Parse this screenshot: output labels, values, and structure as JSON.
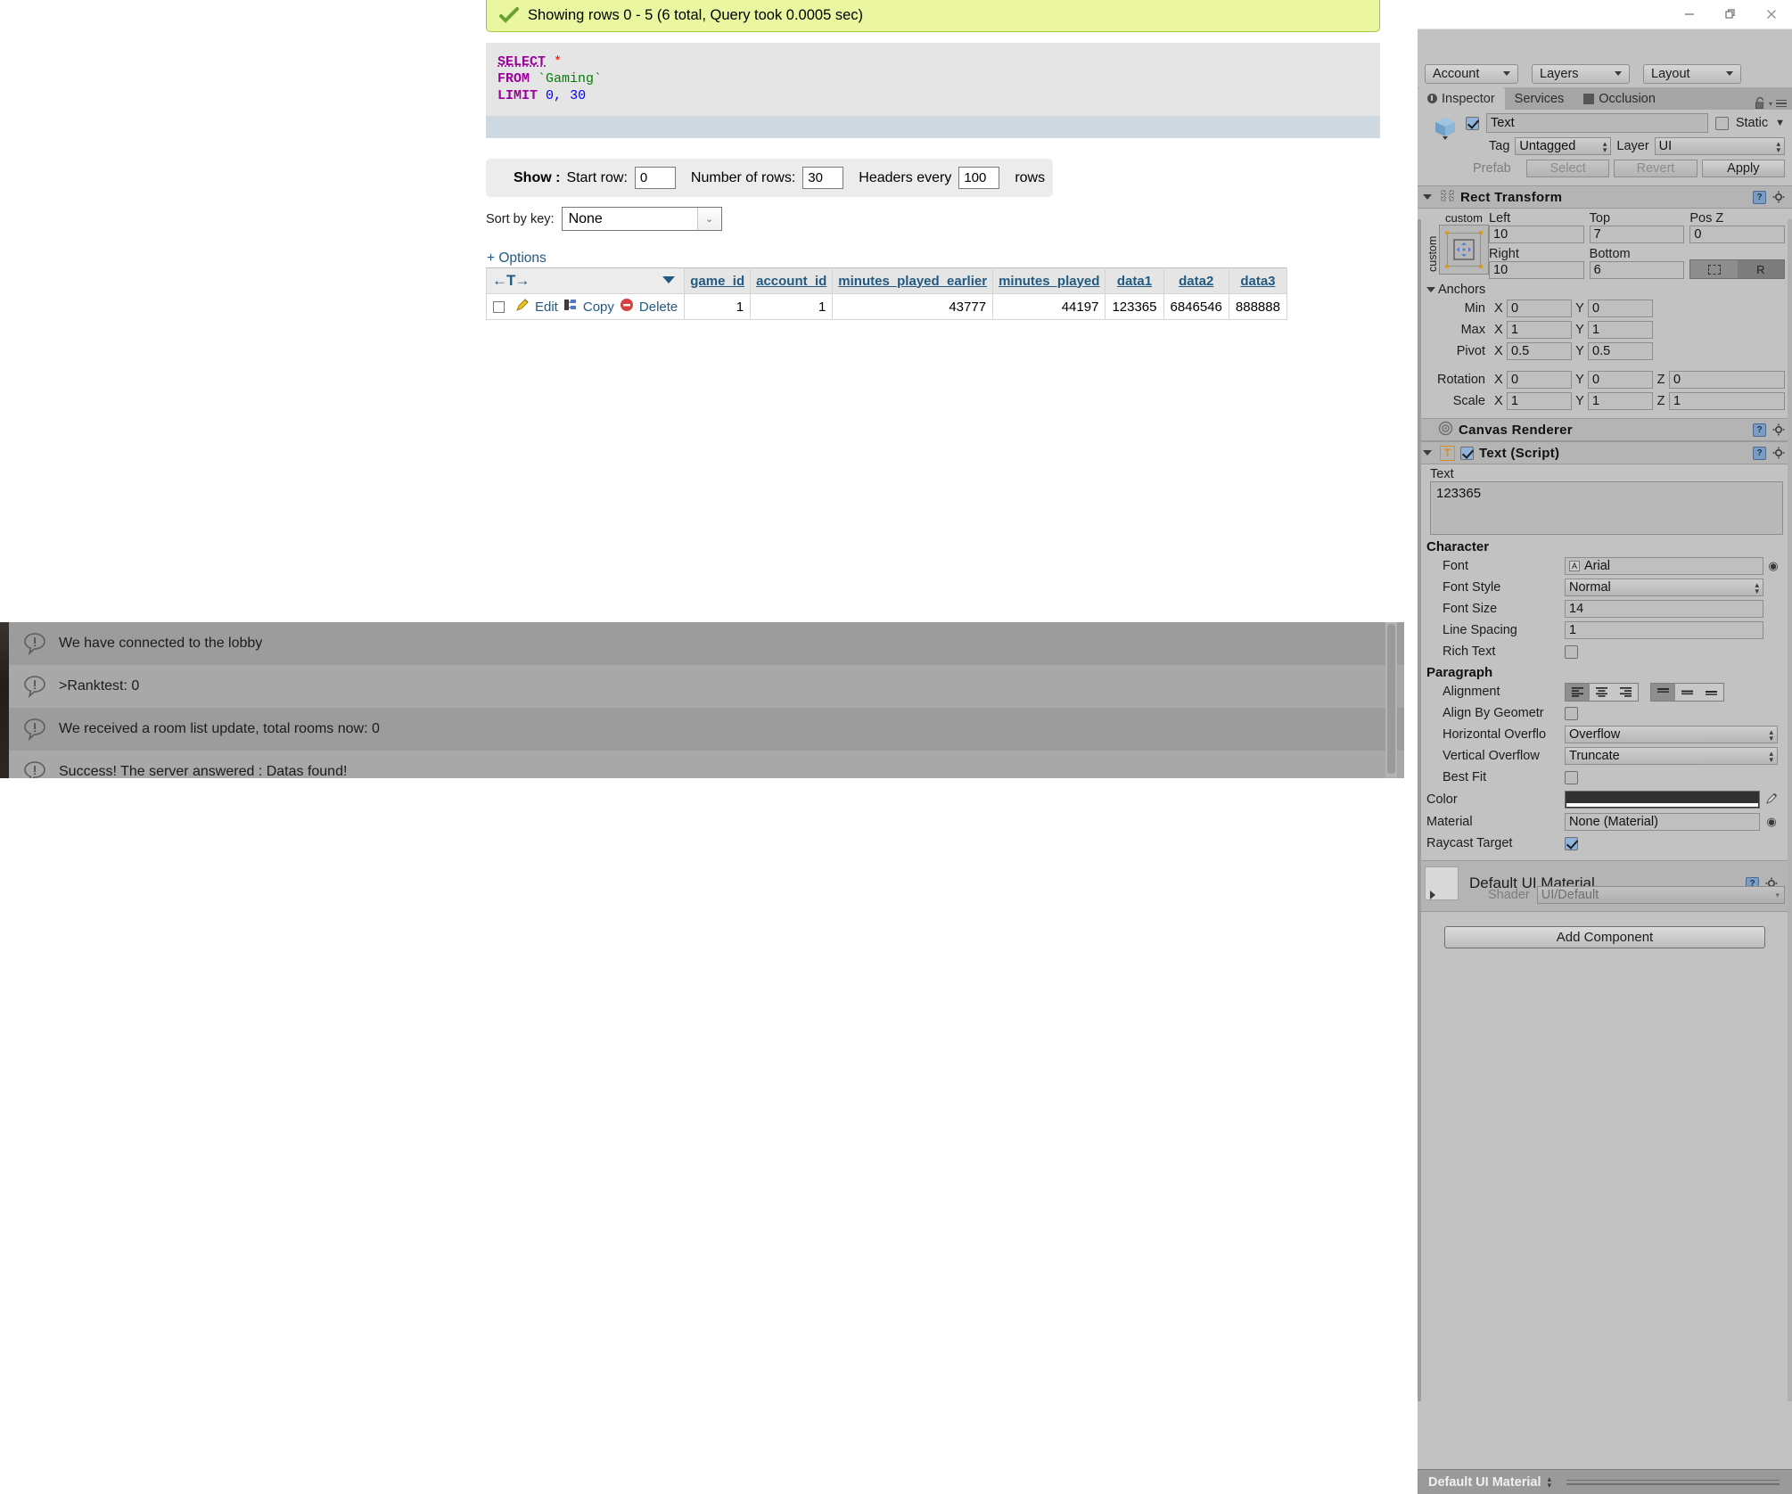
{
  "phpmyadmin": {
    "success_message": "Showing rows 0 - 5 (6 total, Query took 0.0005 sec)",
    "sql": {
      "select_kw": "SELECT",
      "star": "*",
      "from_kw": "FROM",
      "table_name": "`Gaming`",
      "limit_kw": "LIMIT",
      "limit_start": "0",
      "limit_comma": ",",
      "limit_count": "30"
    },
    "show_bar": {
      "show_label": "Show :",
      "start_row_label": "Start row:",
      "start_row_value": "0",
      "number_of_rows_label": "Number of rows:",
      "number_of_rows_value": "30",
      "headers_every_label": "Headers every",
      "headers_every_value": "100",
      "rows_suffix": "rows"
    },
    "sort": {
      "label": "Sort by key:",
      "selected": "None"
    },
    "options_link": "+ Options",
    "table": {
      "nav_glyph": "←T→",
      "columns": [
        "game_id",
        "account_id",
        "minutes_played_earlier",
        "minutes_played",
        "data1",
        "data2",
        "data3"
      ],
      "row_actions": [
        "Edit",
        "Copy",
        "Delete"
      ],
      "rows": [
        {
          "game_id": "1",
          "account_id": "1",
          "minutes_played_earlier": "43777",
          "minutes_played": "44197",
          "data1": "123365",
          "data2": "6846546",
          "data3": "888888"
        }
      ]
    }
  },
  "console": {
    "logs": [
      "We have connected to the lobby",
      ">Ranktest: 0",
      "We received a room list update, total rooms now: 0",
      "Success! The server answered : Datas found!"
    ]
  },
  "unity": {
    "window_buttons": [
      "minimize",
      "restore",
      "close"
    ],
    "toolbar": {
      "account": "Account",
      "layers": "Layers",
      "layout": "Layout"
    },
    "tabs": [
      {
        "label": "Inspector",
        "active": true
      },
      {
        "label": "Services",
        "active": false
      },
      {
        "label": "Occlusion",
        "active": false
      }
    ],
    "object": {
      "enabled": true,
      "name": "Text",
      "static_label": "Static",
      "static_checked": false,
      "tag_label": "Tag",
      "tag_value": "Untagged",
      "layer_label": "Layer",
      "layer_value": "UI",
      "prefab_label": "Prefab",
      "prefab_select": "Select",
      "prefab_revert": "Revert",
      "prefab_apply": "Apply"
    },
    "rect_transform": {
      "title": "Rect Transform",
      "anchor_preset_top": "custom",
      "anchor_preset_left": "custom",
      "left_label": "Left",
      "left_value": "10",
      "top_label": "Top",
      "top_value": "7",
      "posz_label": "Pos Z",
      "posz_value": "0",
      "right_label": "Right",
      "right_value": "10",
      "bottom_label": "Bottom",
      "bottom_value": "6",
      "blueprint_label": "",
      "raw_label": "R",
      "anchors_label": "Anchors",
      "min_label": "Min",
      "min_x": "0",
      "min_y": "0",
      "max_label": "Max",
      "max_x": "1",
      "max_y": "1",
      "pivot_label": "Pivot",
      "pivot_x": "0.5",
      "pivot_y": "0.5",
      "rotation_label": "Rotation",
      "rot_x": "0",
      "rot_y": "0",
      "rot_z": "0",
      "scale_label": "Scale",
      "scale_x": "1",
      "scale_y": "1",
      "scale_z": "1",
      "axis_x": "X",
      "axis_y": "Y",
      "axis_z": "Z"
    },
    "canvas_renderer": {
      "title": "Canvas Renderer"
    },
    "text_script": {
      "title": "Text (Script)",
      "enabled": true,
      "text_label": "Text",
      "text_value": "123365",
      "character_header": "Character",
      "font_label": "Font",
      "font_value": "Arial",
      "font_style_label": "Font Style",
      "font_style_value": "Normal",
      "font_size_label": "Font Size",
      "font_size_value": "14",
      "line_spacing_label": "Line Spacing",
      "line_spacing_value": "1",
      "rich_text_label": "Rich Text",
      "rich_text_checked": false,
      "paragraph_header": "Paragraph",
      "alignment_label": "Alignment",
      "align_by_geometry_label": "Align By Geometr",
      "align_by_geometry_checked": false,
      "horizontal_overflow_label": "Horizontal Overflo",
      "horizontal_overflow_value": "Overflow",
      "vertical_overflow_label": "Vertical Overflow",
      "vertical_overflow_value": "Truncate",
      "best_fit_label": "Best Fit",
      "best_fit_checked": false,
      "color_label": "Color",
      "color_value": "#323232",
      "material_label": "Material",
      "material_value": "None (Material)",
      "raycast_target_label": "Raycast Target",
      "raycast_target_checked": true
    },
    "material": {
      "title": "Default UI Material",
      "shader_label": "Shader",
      "shader_value": "UI/Default"
    },
    "add_component_label": "Add Component",
    "status_bar": {
      "label": "Default UI Material"
    }
  }
}
